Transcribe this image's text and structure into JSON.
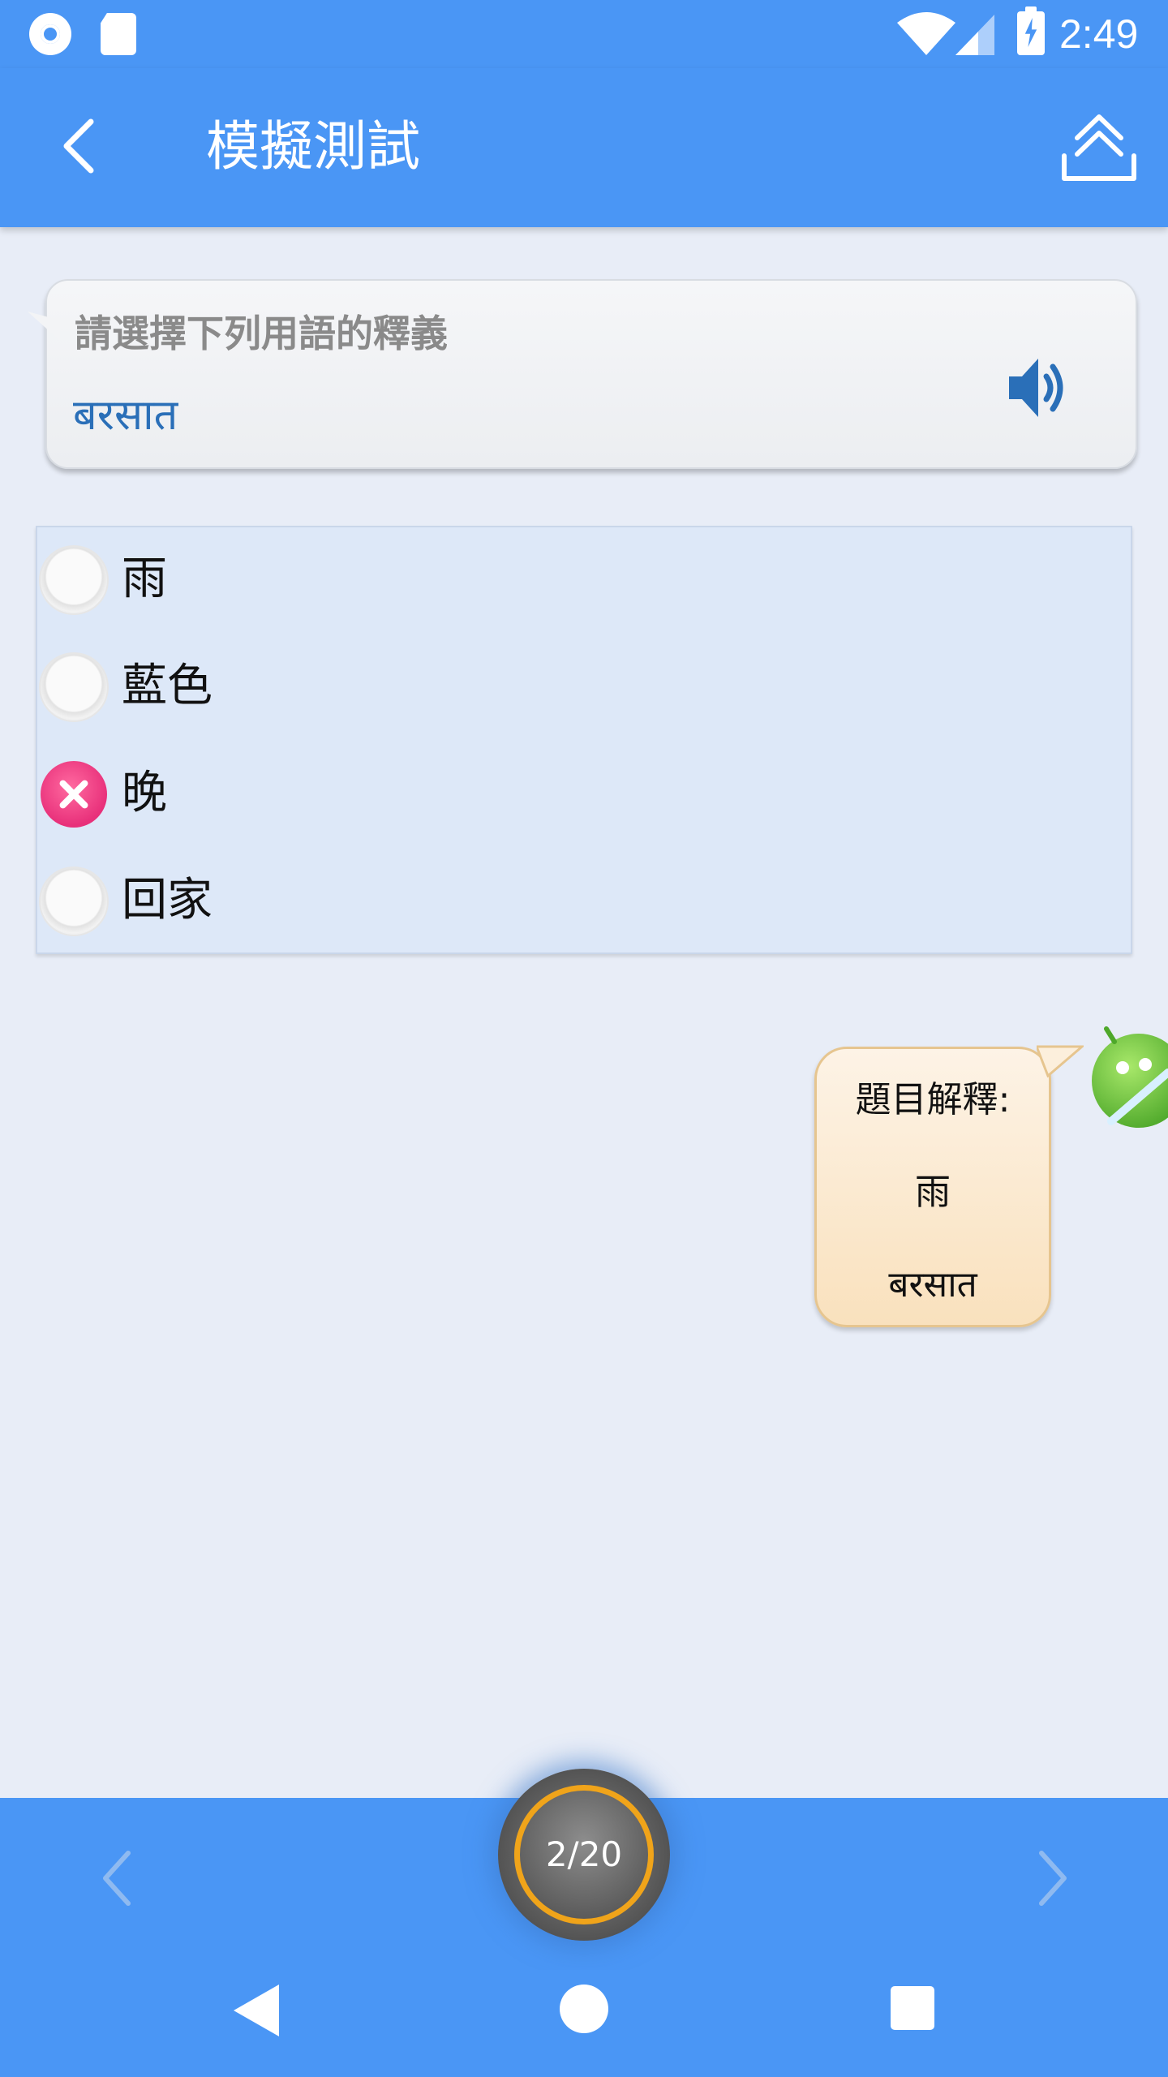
{
  "status_bar": {
    "time": "2:49",
    "icons": [
      "record-icon",
      "sd-card-icon",
      "wifi-icon",
      "signal-icon",
      "battery-charging-icon"
    ]
  },
  "app_bar": {
    "title": "模擬測試",
    "back_icon": "chevron-left-icon",
    "share_icon": "upload-icon"
  },
  "question": {
    "prompt": "請選擇下列用語的釋義",
    "term": "बरसात",
    "speaker_icon": "speaker-icon"
  },
  "options": [
    {
      "label": "雨",
      "state": "unselected"
    },
    {
      "label": "藍色",
      "state": "unselected"
    },
    {
      "label": "晚",
      "state": "wrong"
    },
    {
      "label": "回家",
      "state": "unselected"
    }
  ],
  "explanation": {
    "title": "題目解釋:",
    "answer": "雨",
    "term": "बरसात"
  },
  "pager": {
    "counter": "2/20",
    "prev_icon": "chevron-left-icon",
    "next_icon": "chevron-right-icon"
  },
  "colors": {
    "primary": "#4a96f5",
    "background": "#e8edf7",
    "wrong": "#e8307a",
    "accent_ring": "#f0a41a",
    "term_text": "#2a6fb8"
  }
}
